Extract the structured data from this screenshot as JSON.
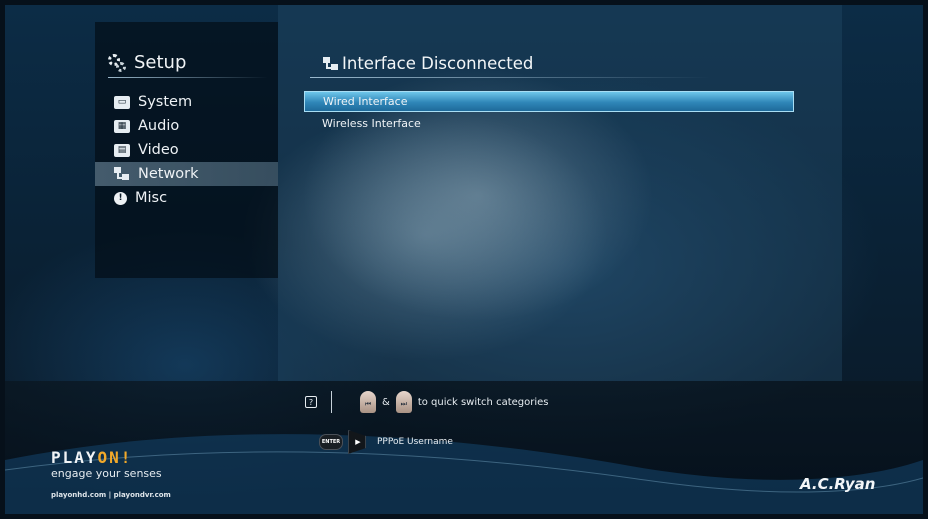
{
  "sidebar": {
    "title": "Setup",
    "items": [
      {
        "label": "System",
        "icon": "system-icon",
        "active": false
      },
      {
        "label": "Audio",
        "icon": "audio-icon",
        "active": false
      },
      {
        "label": "Video",
        "icon": "video-icon",
        "active": false
      },
      {
        "label": "Network",
        "icon": "network-icon",
        "active": true
      },
      {
        "label": "Misc",
        "icon": "info-icon",
        "active": false
      }
    ]
  },
  "main": {
    "title": "Interface Disconnected",
    "items": [
      {
        "label": "Wired Interface",
        "selected": true
      },
      {
        "label": "Wireless Interface",
        "selected": false
      }
    ]
  },
  "hints": {
    "amp": "&",
    "quick_switch": "to quick switch categories",
    "enter_label": "ENTER",
    "pppoe": "PPPoE Username"
  },
  "brand": {
    "logo_main": "PLAY",
    "logo_accent": "ON!",
    "tagline": "engage your senses",
    "urls": "playonhd.com | playondvr.com",
    "maker": "A.C.Ryan"
  },
  "colors": {
    "selection": "#2f86b8",
    "brand_accent": "#f2a92a"
  }
}
